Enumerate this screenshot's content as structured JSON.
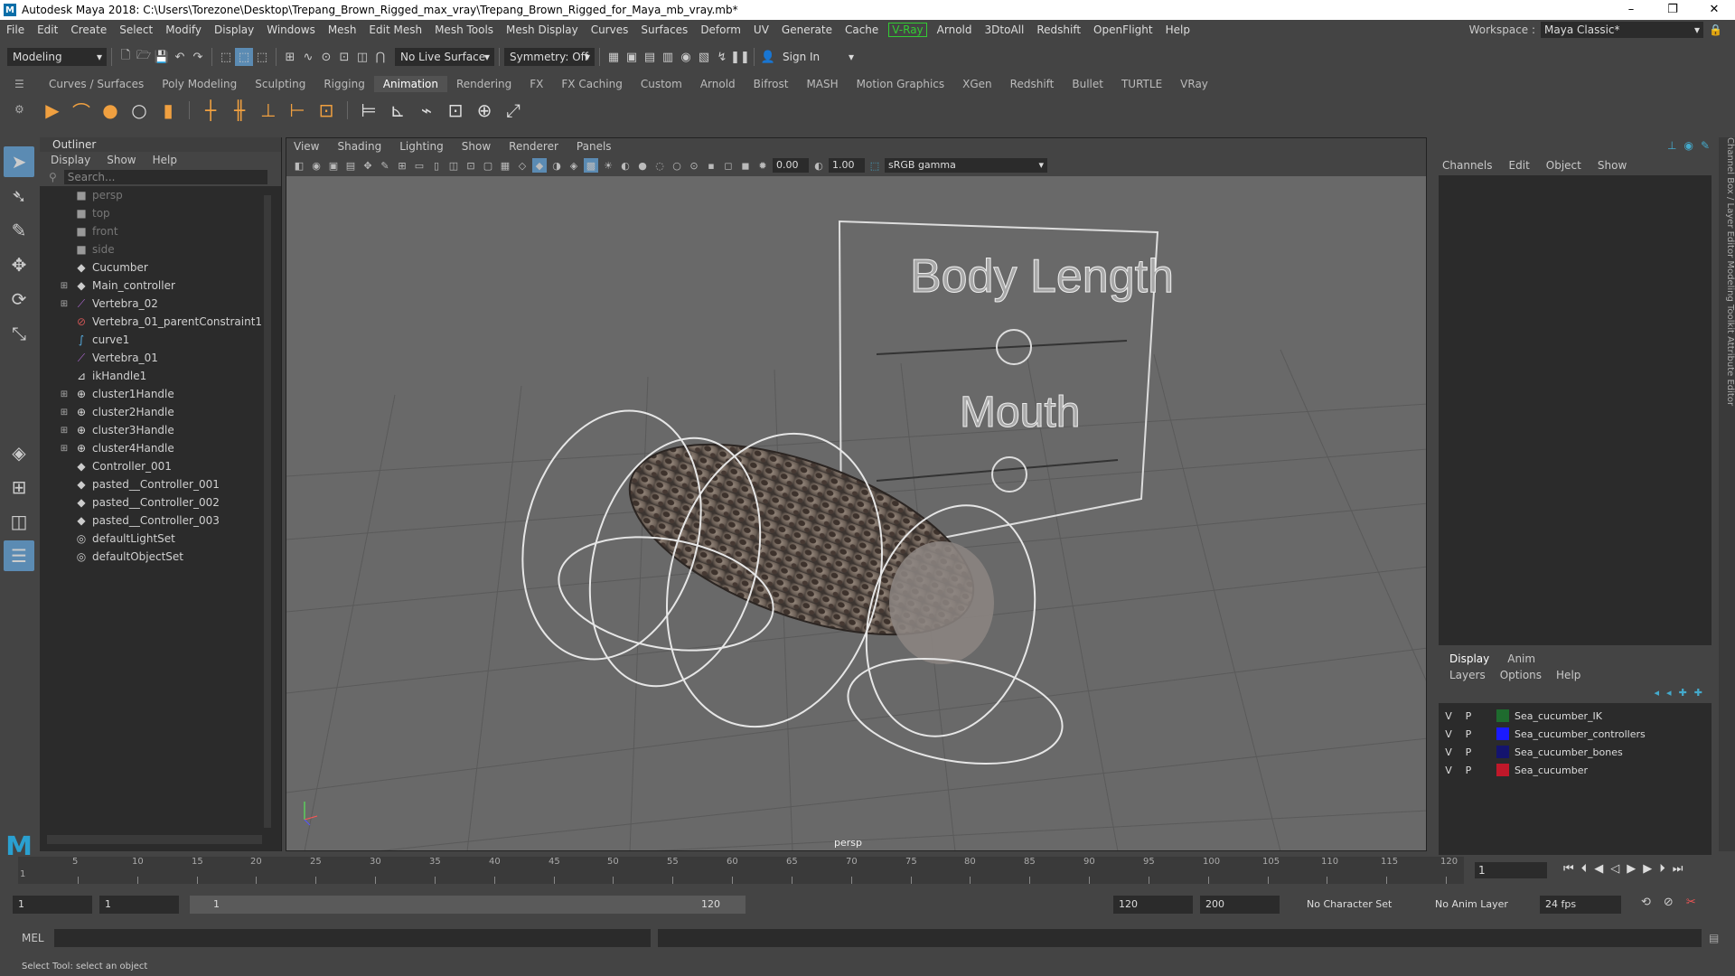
{
  "title": "Autodesk Maya 2018: C:\\Users\\Torezone\\Desktop\\Trepang_Brown_Rigged_max_vray\\Trepang_Brown_Rigged_for_Maya_mb_vray.mb*",
  "menus": [
    "File",
    "Edit",
    "Create",
    "Select",
    "Modify",
    "Display",
    "Windows",
    "Mesh",
    "Edit Mesh",
    "Mesh Tools",
    "Mesh Display",
    "Curves",
    "Surfaces",
    "Deform",
    "UV",
    "Generate",
    "Cache",
    "V-Ray",
    "Arnold",
    "3DtoAll",
    "Redshift",
    "OpenFlight",
    "Help"
  ],
  "workspace": {
    "label": "Workspace :",
    "value": "Maya Classic*"
  },
  "status": {
    "mode": "Modeling",
    "live_surface": "No Live Surface",
    "symmetry": "Symmetry: Off",
    "sign_in": "Sign In"
  },
  "shelf_tabs": [
    "Curves / Surfaces",
    "Poly Modeling",
    "Sculpting",
    "Rigging",
    "Animation",
    "Rendering",
    "FX",
    "FX Caching",
    "Custom",
    "Arnold",
    "Bifrost",
    "MASH",
    "Motion Graphics",
    "XGen",
    "Redshift",
    "Bullet",
    "TURTLE",
    "VRay"
  ],
  "shelf_active": "Animation",
  "outliner": {
    "title": "Outliner",
    "menu": [
      "Display",
      "Show",
      "Help"
    ],
    "search_placeholder": "Search...",
    "items": [
      {
        "label": "persp",
        "icon": "camera-icon",
        "dim": true,
        "expand": ""
      },
      {
        "label": "top",
        "icon": "camera-icon",
        "dim": true,
        "expand": ""
      },
      {
        "label": "front",
        "icon": "camera-icon",
        "dim": true,
        "expand": ""
      },
      {
        "label": "side",
        "icon": "camera-icon",
        "dim": true,
        "expand": ""
      },
      {
        "label": "Cucumber",
        "icon": "transform-icon",
        "dim": false,
        "expand": ""
      },
      {
        "label": "Main_controller",
        "icon": "transform-icon",
        "dim": false,
        "expand": "+"
      },
      {
        "label": "Vertebra_02",
        "icon": "joint-icon",
        "dim": false,
        "expand": "+"
      },
      {
        "label": "Vertebra_01_parentConstraint1",
        "icon": "constraint-icon",
        "dim": false,
        "expand": ""
      },
      {
        "label": "curve1",
        "icon": "curve-icon",
        "dim": false,
        "expand": ""
      },
      {
        "label": "Vertebra_01",
        "icon": "joint-icon",
        "dim": false,
        "expand": ""
      },
      {
        "label": "ikHandle1",
        "icon": "ik-handle-icon",
        "dim": false,
        "expand": ""
      },
      {
        "label": "cluster1Handle",
        "icon": "cluster-icon",
        "dim": false,
        "expand": "+"
      },
      {
        "label": "cluster2Handle",
        "icon": "cluster-icon",
        "dim": false,
        "expand": "+"
      },
      {
        "label": "cluster3Handle",
        "icon": "cluster-icon",
        "dim": false,
        "expand": "+"
      },
      {
        "label": "cluster4Handle",
        "icon": "cluster-icon",
        "dim": false,
        "expand": "+"
      },
      {
        "label": "Controller_001",
        "icon": "transform-icon",
        "dim": false,
        "expand": ""
      },
      {
        "label": "pasted__Controller_001",
        "icon": "transform-icon",
        "dim": false,
        "expand": ""
      },
      {
        "label": "pasted__Controller_002",
        "icon": "transform-icon",
        "dim": false,
        "expand": ""
      },
      {
        "label": "pasted__Controller_003",
        "icon": "transform-icon",
        "dim": false,
        "expand": ""
      },
      {
        "label": "defaultLightSet",
        "icon": "set-icon",
        "dim": false,
        "expand": ""
      },
      {
        "label": "defaultObjectSet",
        "icon": "set-icon",
        "dim": false,
        "expand": ""
      }
    ]
  },
  "viewport": {
    "menu": [
      "View",
      "Shading",
      "Lighting",
      "Show",
      "Renderer",
      "Panels"
    ],
    "exposure": "0.00",
    "gamma": "1.00",
    "colorspace": "sRGB gamma",
    "camera_label": "persp",
    "board_text_1": "Body Length",
    "board_text_2": "Mouth"
  },
  "channelbox": {
    "menu": [
      "Channels",
      "Edit",
      "Object",
      "Show"
    ],
    "layer_tabs": [
      "Display",
      "Anim"
    ],
    "layer_menu": [
      "Layers",
      "Options",
      "Help"
    ],
    "layers": [
      {
        "v": "V",
        "p": "P",
        "color": "#1e6b2e",
        "name": "Sea_cucumber_IK"
      },
      {
        "v": "V",
        "p": "P",
        "color": "#1a1aff",
        "name": "Sea_cucumber_controllers"
      },
      {
        "v": "V",
        "p": "P",
        "color": "#14146e",
        "name": "Sea_cucumber_bones"
      },
      {
        "v": "V",
        "p": "P",
        "color": "#c0182a",
        "name": "Sea_cucumber"
      }
    ],
    "side_tabs": "Channel Box / Layer Editor   Modeling Toolkit   Attribute Editor"
  },
  "timeline": {
    "ticks": [
      "5",
      "10",
      "15",
      "20",
      "25",
      "30",
      "35",
      "40",
      "45",
      "50",
      "55",
      "60",
      "65",
      "70",
      "75",
      "80",
      "85",
      "90",
      "95",
      "100",
      "105",
      "110",
      "115",
      "120"
    ],
    "start_tick": "1",
    "current": "1"
  },
  "range": {
    "start": "1",
    "play_start": "1",
    "slider_start": "1",
    "slider_end": "120",
    "play_end": "120",
    "end": "200",
    "char_set": "No Character Set",
    "anim_layer": "No Anim Layer",
    "fps": "24 fps"
  },
  "cmd": {
    "label": "MEL"
  },
  "help": "Select Tool: select an object"
}
